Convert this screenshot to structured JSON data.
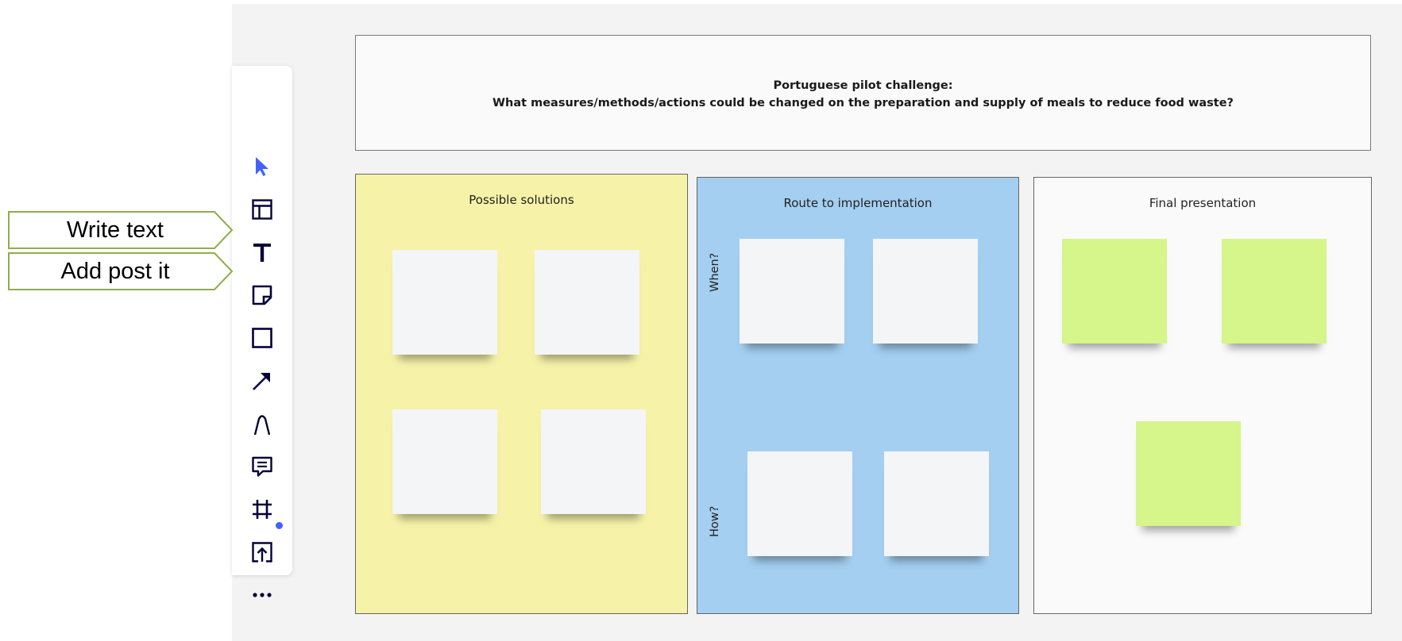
{
  "toolbar": {
    "tools": [
      {
        "name": "select-tool",
        "icon": "cursor-icon",
        "active": true
      },
      {
        "name": "templates-tool",
        "icon": "layout-icon"
      },
      {
        "name": "text-tool",
        "icon": "text-icon"
      },
      {
        "name": "sticky-note-tool",
        "icon": "sticky-note-icon"
      },
      {
        "name": "shape-tool",
        "icon": "square-icon"
      },
      {
        "name": "arrow-tool",
        "icon": "arrow-icon"
      },
      {
        "name": "pen-tool",
        "icon": "pen-icon"
      },
      {
        "name": "comment-tool",
        "icon": "comment-icon"
      },
      {
        "name": "frame-tool",
        "icon": "frame-icon"
      },
      {
        "name": "upload-tool",
        "icon": "upload-icon"
      },
      {
        "name": "more-tools",
        "icon": "more-icon"
      }
    ],
    "active_color": "#4262ff",
    "icon_color": "#050038"
  },
  "callouts": {
    "write_text": "Write text",
    "add_post_it": "Add post it",
    "border_color": "#8fad4c"
  },
  "header": {
    "line1": "Portuguese pilot challenge:",
    "line2": "What measures/methods/actions could be changed on the preparation and supply of meals to reduce food waste?"
  },
  "columns": {
    "solutions": {
      "title": "Possible solutions",
      "color": "#f6f2a8"
    },
    "route": {
      "title": "Route to implementation",
      "color": "#a4cff0",
      "row_labels": [
        "When?",
        "How?"
      ]
    },
    "final": {
      "title": "Final presentation",
      "color": "#fafafa"
    }
  },
  "sticky_colors": {
    "white": "#f4f5f7",
    "green": "#d6f58a"
  }
}
